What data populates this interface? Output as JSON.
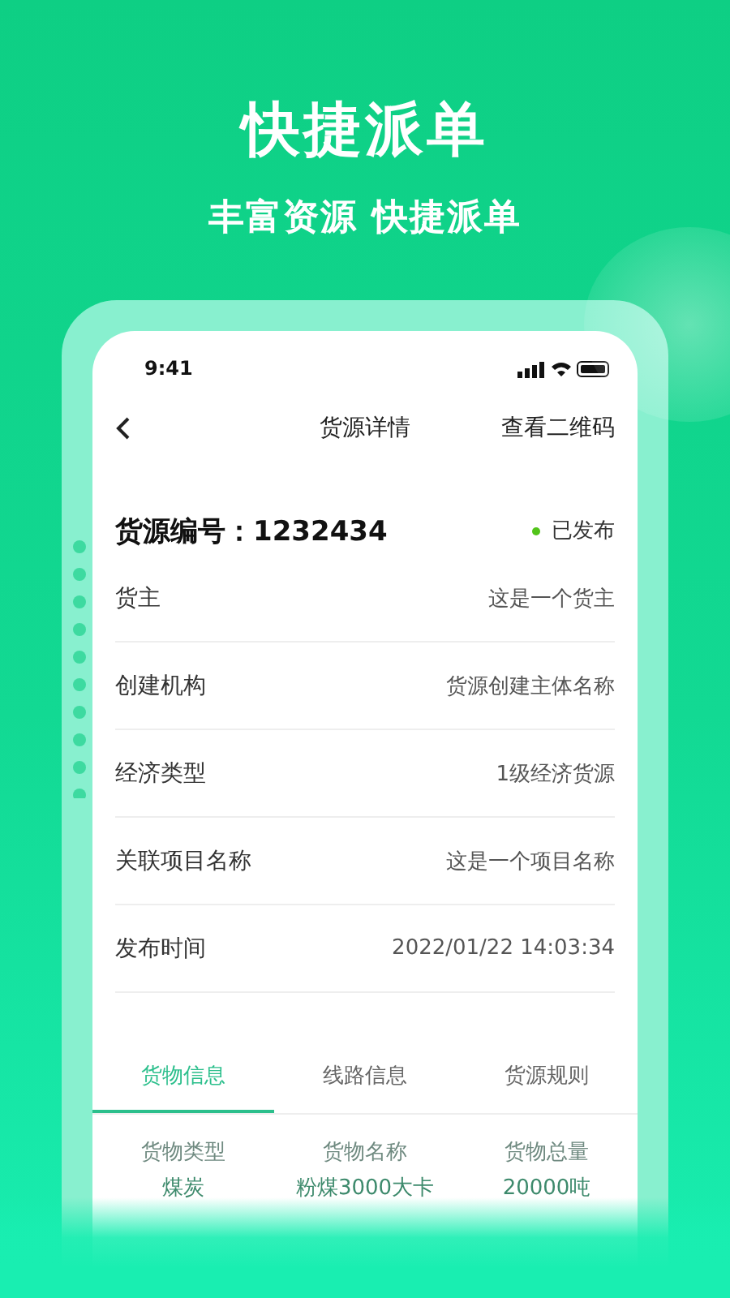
{
  "headline": "快捷派单",
  "subheadline": "丰富资源 快捷派单",
  "status_bar": {
    "time": "9:41"
  },
  "nav": {
    "title": "货源详情",
    "action": "查看二维码"
  },
  "source": {
    "label": "货源编号：",
    "number": "1232434",
    "status": "已发布"
  },
  "fields": [
    {
      "label": "货主",
      "value": "这是一个货主"
    },
    {
      "label": "创建机构",
      "value": "货源创建主体名称"
    },
    {
      "label": "经济类型",
      "value": "1级经济货源"
    },
    {
      "label": "关联项目名称",
      "value": "这是一个项目名称"
    },
    {
      "label": "发布时间",
      "value": "2022/01/22 14:03:34"
    }
  ],
  "tabs": [
    {
      "label": "货物信息",
      "selected": true
    },
    {
      "label": "线路信息",
      "selected": false
    },
    {
      "label": "货源规则",
      "selected": false
    }
  ],
  "cargo_table": {
    "columns": [
      "货物类型",
      "货物名称",
      "货物总量"
    ],
    "rows": [
      [
        "煤炭",
        "粉煤3000大卡",
        "20000吨"
      ]
    ]
  }
}
